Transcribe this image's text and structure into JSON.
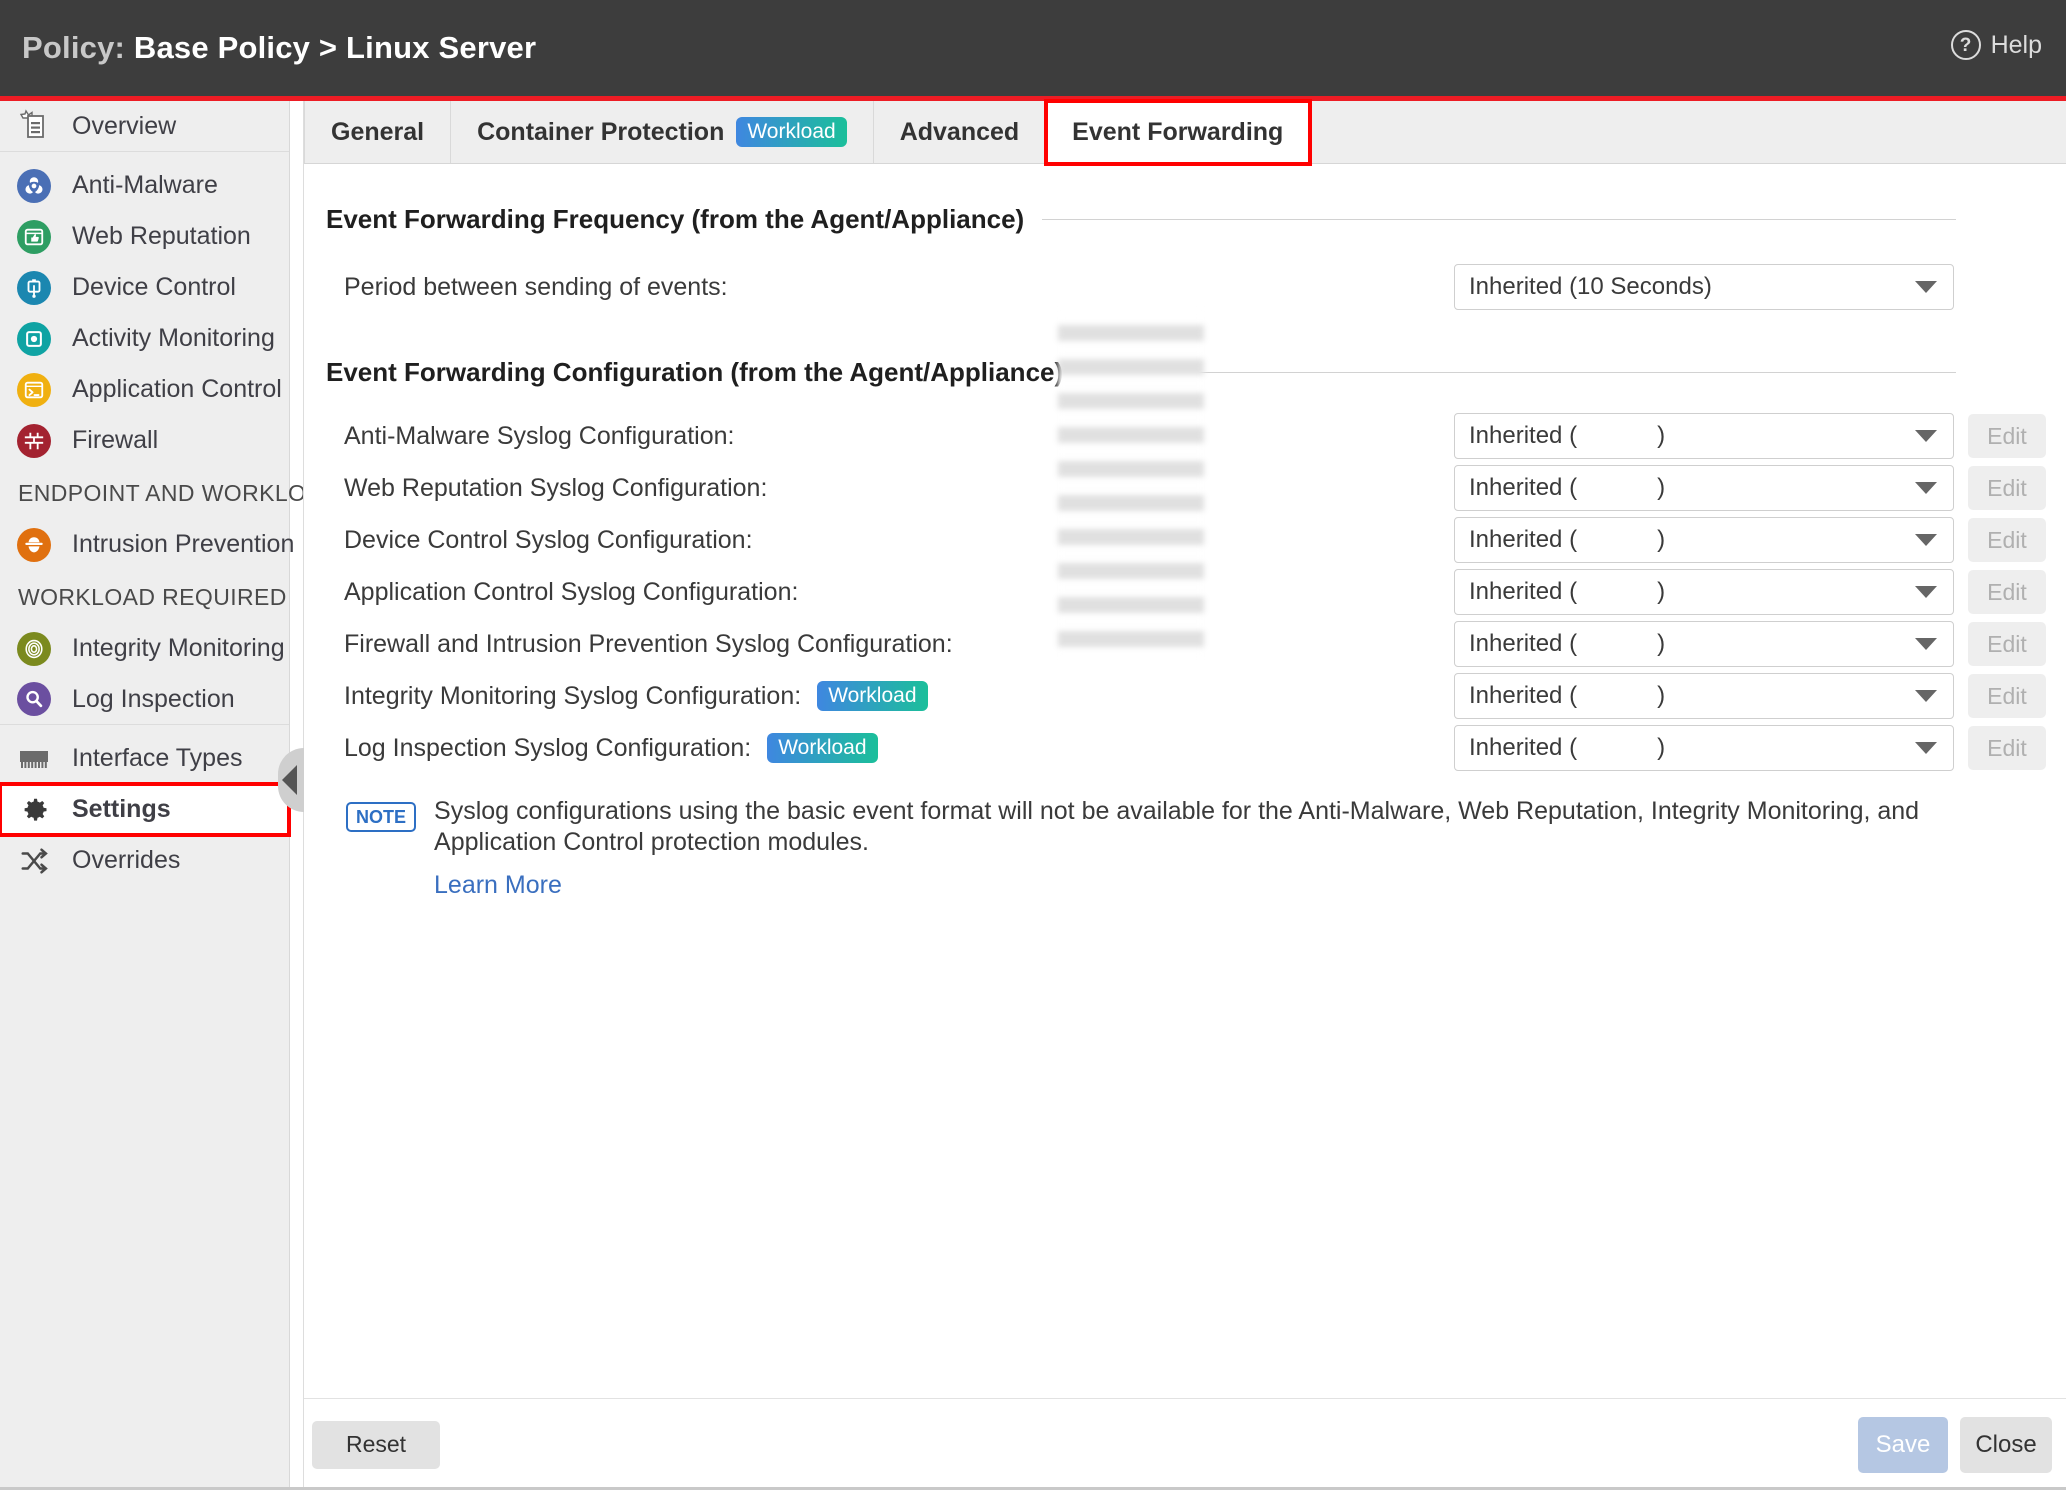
{
  "titlebar": {
    "title_lead": "Policy:",
    "title_main": "Base Policy > Linux Server",
    "help_label": "Help",
    "help_icon": "question-circle-icon",
    "bg_color": "#3d3d3d",
    "accent_color": "#ed1c24"
  },
  "sidebar": {
    "items": [
      {
        "label": "Overview",
        "icon": "overview-document-icon",
        "icon_color": "#6b6b6b"
      },
      {
        "label": "Anti-Malware",
        "icon": "biohazard-icon",
        "icon_color": "#4a6fb5"
      },
      {
        "label": "Web Reputation",
        "icon": "thumbs-up-browser-icon",
        "icon_color": "#2e9e63"
      },
      {
        "label": "Device Control",
        "icon": "usb-shield-icon",
        "icon_color": "#1b87b0"
      },
      {
        "label": "Activity Monitoring",
        "icon": "square-target-icon",
        "icon_color": "#0fa3a3"
      },
      {
        "label": "Application Control",
        "icon": "terminal-window-icon",
        "icon_color": "#f0b010"
      },
      {
        "label": "Firewall",
        "icon": "brick-wall-icon",
        "icon_color": "#a32230"
      }
    ],
    "group_endpoint": "ENDPOINT AND WORKLOAD",
    "items_endpoint": [
      {
        "label": "Intrusion Prevention",
        "icon": "detective-hat-icon",
        "icon_color": "#e0700f"
      }
    ],
    "group_workload": "WORKLOAD REQUIRED",
    "items_workload": [
      {
        "label": "Integrity Monitoring",
        "icon": "fingerprint-icon",
        "icon_color": "#7b8a1e"
      },
      {
        "label": "Log Inspection",
        "icon": "magnifier-icon",
        "icon_color": "#6b4fa0"
      }
    ],
    "items_bottom": [
      {
        "label": "Interface Types",
        "icon": "network-card-icon",
        "icon_color": "#6b6b6b"
      },
      {
        "label": "Settings",
        "icon": "gear-icon",
        "icon_color": "#3a3a3a"
      },
      {
        "label": "Overrides",
        "icon": "shuffle-arrows-icon",
        "icon_color": "#4a4a4a"
      }
    ],
    "active_item": "Settings",
    "highlight_color": "#ff0000",
    "collapse_handle_icon": "chevron-left-icon"
  },
  "tabs": [
    {
      "label": "General",
      "badge": null,
      "active": false
    },
    {
      "label": "Container Protection",
      "badge": "Workload",
      "active": false
    },
    {
      "label": "Advanced",
      "badge": null,
      "active": false
    },
    {
      "label": "Event Forwarding",
      "badge": null,
      "active": true,
      "highlighted": true
    }
  ],
  "sections": {
    "frequency": {
      "heading": "Event Forwarding Frequency (from the Agent/Appliance)",
      "row_label": "Period between sending of events:",
      "row_value": "Inherited (10 Seconds)"
    },
    "configuration": {
      "heading": "Event Forwarding Configuration (from the Agent/Appliance)",
      "edit_label": "Edit",
      "rows": [
        {
          "label": "Anti-Malware Syslog Configuration:",
          "badge": null,
          "value": "Inherited (",
          "value_suffix": ")",
          "obscured": true
        },
        {
          "label": "Web Reputation Syslog Configuration:",
          "badge": null,
          "value": "Inherited (",
          "value_suffix": ")",
          "obscured": true
        },
        {
          "label": "Device Control Syslog Configuration:",
          "badge": null,
          "value": "Inherited (",
          "value_suffix": ")",
          "obscured": true
        },
        {
          "label": "Application Control Syslog Configuration:",
          "badge": null,
          "value": "Inherited (",
          "value_suffix": ")",
          "obscured": true
        },
        {
          "label": "Firewall and Intrusion Prevention Syslog Configuration:",
          "badge": null,
          "value": "Inherited (",
          "value_suffix": ")",
          "obscured": true
        },
        {
          "label": "Integrity Monitoring Syslog Configuration:",
          "badge": "Workload",
          "value": "Inherited (",
          "value_suffix": ")",
          "obscured": true
        },
        {
          "label": "Log Inspection Syslog Configuration:",
          "badge": "Workload",
          "value": "Inherited (",
          "value_suffix": ")",
          "obscured": true
        }
      ]
    }
  },
  "note": {
    "badge": "NOTE",
    "text": "Syslog configurations using the basic event format will not be available for the Anti-Malware, Web Reputation, Integrity Monitoring, and Application Control protection modules.",
    "link": "Learn More",
    "badge_color": "#2d6fc4",
    "link_color": "#3a6fbf"
  },
  "footer": {
    "reset_label": "Reset",
    "save_label": "Save",
    "close_label": "Close",
    "save_color": "#b5c7e3"
  }
}
